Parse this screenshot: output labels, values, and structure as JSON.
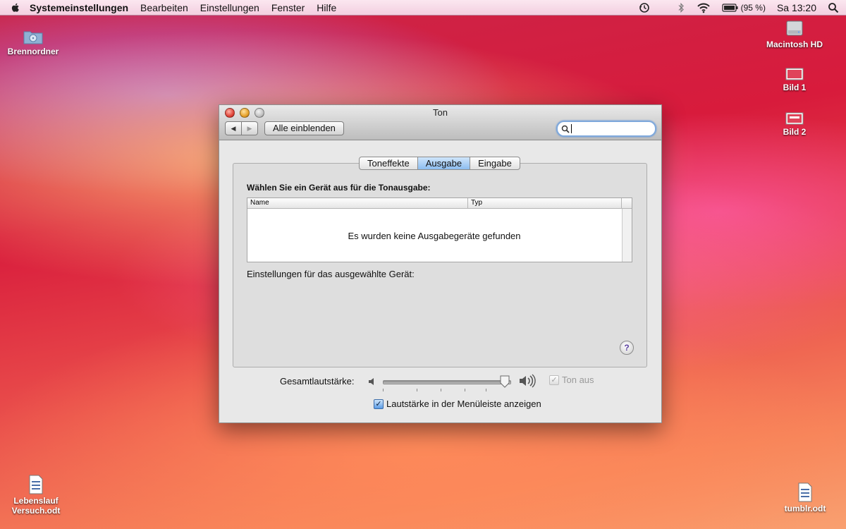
{
  "menubar": {
    "app_name": "Systemeinstellungen",
    "items": [
      "Bearbeiten",
      "Einstellungen",
      "Fenster",
      "Hilfe"
    ],
    "battery_text": "(95 %)",
    "clock": "Sa 13:20"
  },
  "desktop": {
    "icons": [
      {
        "label": "Brennordner"
      },
      {
        "label": "Macintosh HD"
      },
      {
        "label": "Bild 1"
      },
      {
        "label": "Bild 2"
      },
      {
        "label_line1": "Lebenslauf",
        "label_line2": "Versuch.odt"
      },
      {
        "label": "tumblr.odt"
      }
    ]
  },
  "window": {
    "title": "Ton",
    "show_all": "Alle einblenden",
    "search_value": "",
    "tabs": [
      {
        "label": "Toneffekte",
        "selected": false
      },
      {
        "label": "Ausgabe",
        "selected": true
      },
      {
        "label": "Eingabe",
        "selected": false
      }
    ],
    "heading": "Wählen Sie ein Gerät aus für die Tonausgabe:",
    "columns": [
      "Name",
      "Typ"
    ],
    "empty_message": "Es wurden keine Ausgabegeräte gefunden",
    "settings_label": "Einstellungen für das ausgewählte Gerät:",
    "help": "?",
    "volume_label": "Gesamtlautstärke:",
    "volume_level": 0.96,
    "mute_label": "Ton aus",
    "mute_checked": true,
    "show_in_menubar_label": "Lautstärke in der Menüleiste anzeigen",
    "show_in_menubar_checked": true
  },
  "colors": {
    "accent_blue": "#5b9ce6",
    "close_red": "#e0453a",
    "minimize_yellow": "#e6a22a"
  }
}
